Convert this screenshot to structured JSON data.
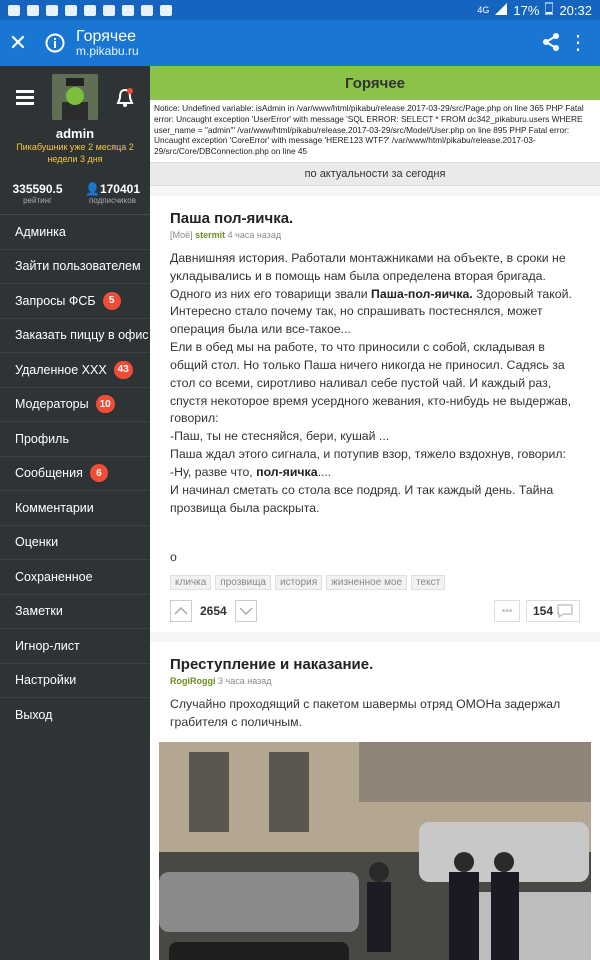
{
  "statusbar": {
    "network": "4G",
    "battery": "17%",
    "time": "20:32"
  },
  "appbar": {
    "title": "Горячее",
    "url": "m.pikabu.ru"
  },
  "sidebar": {
    "username": "admin",
    "subtitle": "Пикабушник уже 2 месяца 2 недели 3 дня",
    "rating_value": "335590.5",
    "rating_label": "рейтинг",
    "subscribers_value": "170401",
    "subscribers_label": "подписчиков",
    "items": [
      {
        "label": "Админка",
        "badge": ""
      },
      {
        "label": "Зайти пользователем",
        "badge": ""
      },
      {
        "label": "Запросы ФСБ",
        "badge": "5"
      },
      {
        "label": "Заказать пиццу в офис",
        "badge": ""
      },
      {
        "label": "Удаленное XXX",
        "badge": "43"
      },
      {
        "label": "Модераторы",
        "badge": "10"
      },
      {
        "label": "Профиль",
        "badge": ""
      },
      {
        "label": "Сообщения",
        "badge": "6"
      },
      {
        "label": "Комментарии",
        "badge": ""
      },
      {
        "label": "Оценки",
        "badge": ""
      },
      {
        "label": "Сохраненное",
        "badge": ""
      },
      {
        "label": "Заметки",
        "badge": ""
      },
      {
        "label": "Игнор-лист",
        "badge": ""
      },
      {
        "label": "Настройки",
        "badge": ""
      },
      {
        "label": "Выход",
        "badge": ""
      }
    ]
  },
  "content": {
    "header": "Горячее",
    "errors": "Notice: Undefined variable: isAdmin in /var/www/html/pikabu/release.2017-03-29/src/Page.php on line 365 PHP Fatal error: Uncaught exception 'UserError' with message 'SQL ERROR: SELECT * FROM dc342_pikaburu.users WHERE user_name = \"admin\"' /var/www/html/pikabu/release.2017-03-29/src/Model/User.php on line 895 PHP Fatal error: Uncaught exception 'CoreError' with message 'HERE123 WTF?' /var/www/html/pikabu/release.2017-03-29/src/Core/DBConnection.php on line 45",
    "filter": "по актуальности за сегодня"
  },
  "post1": {
    "title": "Паша пол-яичка.",
    "meta_prefix": "[Моё]",
    "author": "stermit",
    "time": "4 часа назад",
    "p1": "Давнишняя история. Работали монтажниками на объекте, в сроки не укладывались и в помощь нам была определена вторая бригада. Одного из них его товарищи звали ",
    "p1_bold": "Паша-пол-яичка.",
    "p1_rest": " Здоровый такой. Интересно стало почему так, но спрашивать постеснялся, может операция была или все-такое...",
    "p2": "Ели в обед мы на работе, то что приносили с собой, складывая в общий стол. Но только Паша ничего никогда не приносил. Садясь за стол со всеми, сиротливо наливал себе пустой чай. И каждый раз, спустя некоторое время усердного жевания, кто-нибудь не выдержав, говорил:",
    "p3": "-Паш, ты не стесняйся, бери, кушай ...",
    "p4": "Паша ждал этого сигнала, и потупив взор, тяжело вздохнув, говорил:",
    "p5_pre": "-Ну, разве что, ",
    "p5_bold": "пол-яичка",
    "p5_post": "....",
    "p6": "И начинал сметать со стола все подряд. И так каждый день. Тайна прозвища была раскрыта.",
    "p7": "о",
    "tags": [
      "кличка",
      "прозвища",
      "история",
      "жизненное мое",
      "текст"
    ],
    "score": "2654",
    "comments": "154"
  },
  "post2": {
    "title": "Преступление и наказание.",
    "author": "RogiRoggi",
    "time": "3 часа назад",
    "body": "Случайно проходящий с пакетом шавермы отряд ОМОНа задержал грабителя с поличным."
  }
}
